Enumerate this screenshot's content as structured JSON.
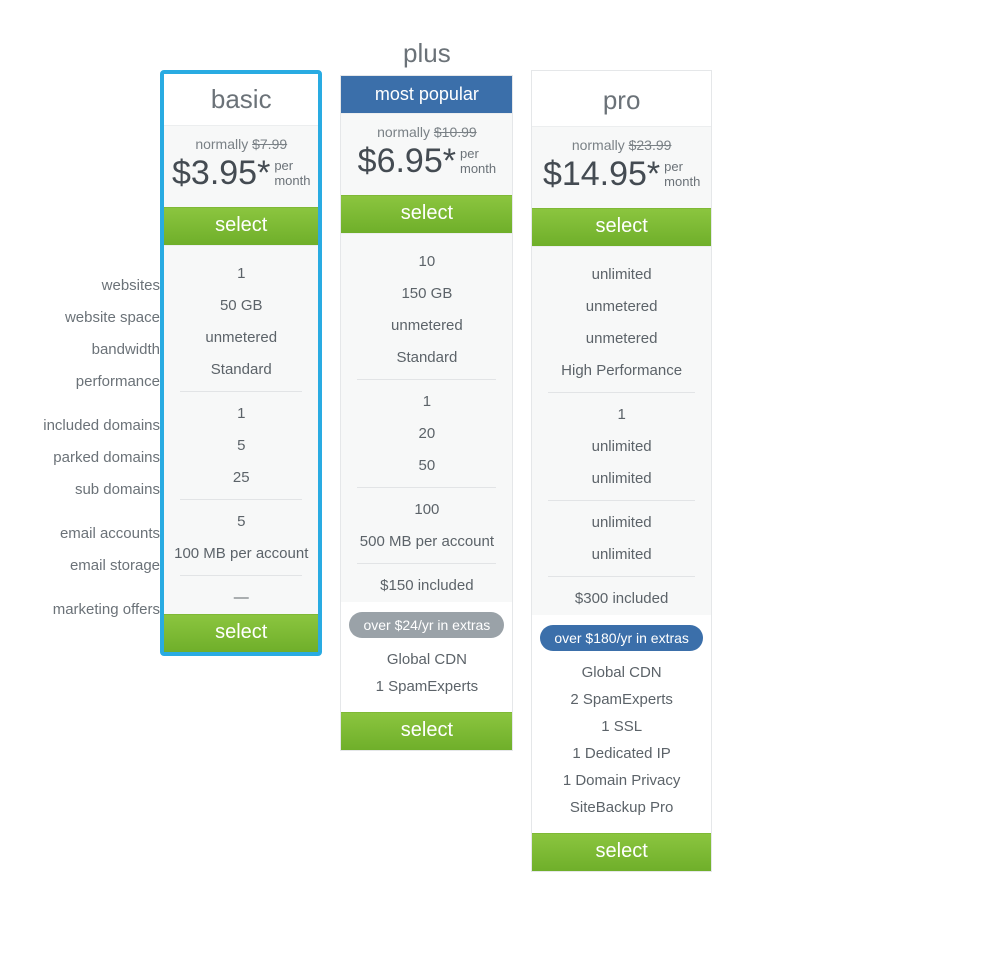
{
  "labels": {
    "websites": "websites",
    "website_space": "website space",
    "bandwidth": "bandwidth",
    "performance": "performance",
    "included_domains": "included domains",
    "parked_domains": "parked domains",
    "sub_domains": "sub domains",
    "email_accounts": "email accounts",
    "email_storage": "email storage",
    "marketing_offers": "marketing offers"
  },
  "common": {
    "normally_prefix": "normally ",
    "per_line1": "per",
    "per_line2": "month",
    "select_label": "select"
  },
  "plans": {
    "basic": {
      "name": "basic",
      "normal_price": "$7.99",
      "price": "$3.95*",
      "features": {
        "websites": "1",
        "website_space": "50 GB",
        "bandwidth": "unmetered",
        "performance": "Standard",
        "included_domains": "1",
        "parked_domains": "5",
        "sub_domains": "25",
        "email_accounts": "5",
        "email_storage": "100 MB per account",
        "marketing_offers": "—"
      }
    },
    "plus": {
      "name": "plus",
      "badge": "most popular",
      "normal_price": "$10.99",
      "price": "$6.95*",
      "features": {
        "websites": "10",
        "website_space": "150 GB",
        "bandwidth": "unmetered",
        "performance": "Standard",
        "included_domains": "1",
        "parked_domains": "20",
        "sub_domains": "50",
        "email_accounts": "100",
        "email_storage": "500 MB per account",
        "marketing_offers": "$150 included"
      },
      "extras_pill": "over $24/yr in extras",
      "extras": [
        "Global CDN",
        "1 SpamExperts"
      ]
    },
    "pro": {
      "name": "pro",
      "normal_price": "$23.99",
      "price": "$14.95*",
      "features": {
        "websites": "unlimited",
        "website_space": "unmetered",
        "bandwidth": "unmetered",
        "performance": "High Performance",
        "included_domains": "1",
        "parked_domains": "unlimited",
        "sub_domains": "unlimited",
        "email_accounts": "unlimited",
        "email_storage": "unlimited",
        "marketing_offers": "$300 included"
      },
      "extras_pill": "over $180/yr in extras",
      "extras": [
        "Global CDN",
        "2 SpamExperts",
        "1 SSL",
        "1 Dedicated IP",
        "1 Domain Privacy",
        "SiteBackup Pro"
      ]
    }
  }
}
